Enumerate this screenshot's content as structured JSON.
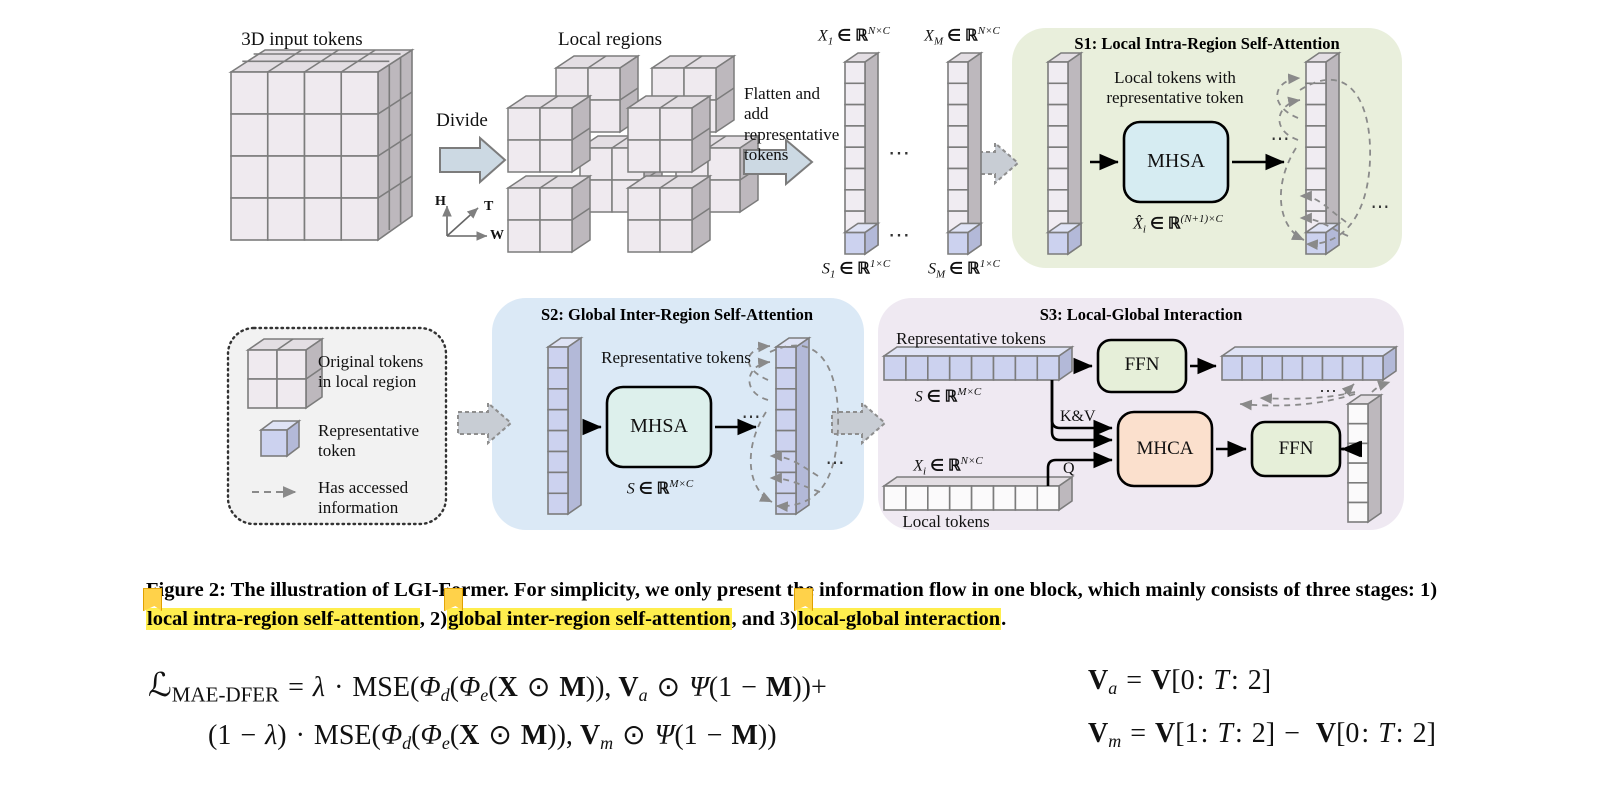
{
  "figure": {
    "id": "figure-2",
    "title": "LGI-Former illustration"
  },
  "stage0": {
    "input_label": "3D input tokens",
    "divide_label": "Divide",
    "local_regions_label": "Local regions",
    "flatten_label": "Flatten and add\nrepresentative\ntokens",
    "flatten_lines": [
      "Flatten and add",
      "representative",
      "tokens"
    ],
    "axes": {
      "h": "H",
      "t": "T",
      "w": "W"
    }
  },
  "tokens_row": {
    "x1_label": "X₁ ∈ ℝ^{N×C}",
    "xm_label": "X_M ∈ ℝ^{N×C}",
    "s1_label": "S₁ ∈ ℝ^{1×C}",
    "sm_label": "S_M ∈ ℝ^{1×C}",
    "ellipsis": "⋯"
  },
  "s1": {
    "title": "S1: Local Intra-Region Self-Attention",
    "caption_lines": [
      "Local tokens with",
      "representative token"
    ],
    "block_label": "MHSA",
    "output_math": "X̂_i ∈ ℝ^{(N+1)×C}",
    "ellipsis": "⋯",
    "bg_color": "#e9efdc",
    "block_fill": "#d6ecf2"
  },
  "legend": {
    "items": [
      {
        "icon": "original-token-cube",
        "lines": [
          "Original tokens",
          "in local region"
        ]
      },
      {
        "icon": "representative-token-cube",
        "lines": [
          "Representative",
          "token"
        ]
      },
      {
        "icon": "dashed-arrow",
        "lines": [
          "Has accessed",
          "information"
        ]
      }
    ],
    "bg_color": "#f2f2f2"
  },
  "s2": {
    "title": "S2: Global Inter-Region Self-Attention",
    "caption": "Representative tokens",
    "block_label": "MHSA",
    "output_math": "S ∈ ℝ^{M×C}",
    "ellipsis": "⋯",
    "bg_color": "#dbe9f6",
    "block_fill": "#ddf0ec"
  },
  "s3": {
    "title": "S3: Local-Global Interaction",
    "rep_tokens_label": "Representative tokens",
    "rep_math": "S ∈ ℝ^{M×C}",
    "local_tokens_label": "Local tokens",
    "local_math": "X_i ∈ ℝ^{N×C}",
    "kv_label": "K&V",
    "q_label": "Q",
    "ffn_top_label": "FFN",
    "ffn_bottom_label": "FFN",
    "mhca_label": "MHCA",
    "ellipsis": "⋯",
    "bg_color": "#efe9f2",
    "ffn_fill": "#e6efd9",
    "mhca_fill": "#fbe0cd"
  },
  "colors": {
    "original_token": "#f0ecf2",
    "representative_token": "#ccd2ef",
    "cube_face": "#eee9ee",
    "cube_side": "#b9b4b9",
    "stroke": "#6e6e6e",
    "dashed_arrow": "#8a8a8a",
    "highlight": "#ffee4d",
    "flag": "#ffd24a"
  },
  "caption": {
    "prefix": "Figure 2: The illustration of LGI-Former. For simplicity, we only present the information flow in one block, which mainly consists of three stages: 1) ",
    "lead": "Figure 2: The illustration of LGI-Former. For simplicity, we only present the information flow in one block, which mainly consists of three stages: 1)",
    "hl1": "local intra-region self-attention",
    "mid1": ", 2)",
    "hl2": "global inter-region self-attention",
    "mid2": ", and 3)",
    "hl3": "local-global interaction",
    "tail": "."
  },
  "equations": {
    "loss_name": "MAE-DFER",
    "line1": "ℒ_MAE-DFER = λ · MSE(Φ_d(Φ_e(X ⊙ M)), V_a ⊙ Ψ(1 − M))+",
    "line2": "(1 − λ) · MSE(Φ_d(Φ_e(X ⊙ M)), V_m ⊙ Ψ(1 − M))",
    "line3": "V_a = V[0: T: 2]",
    "line4": "V_m = V[1: T: 2] −  V[0: T: 2]"
  }
}
